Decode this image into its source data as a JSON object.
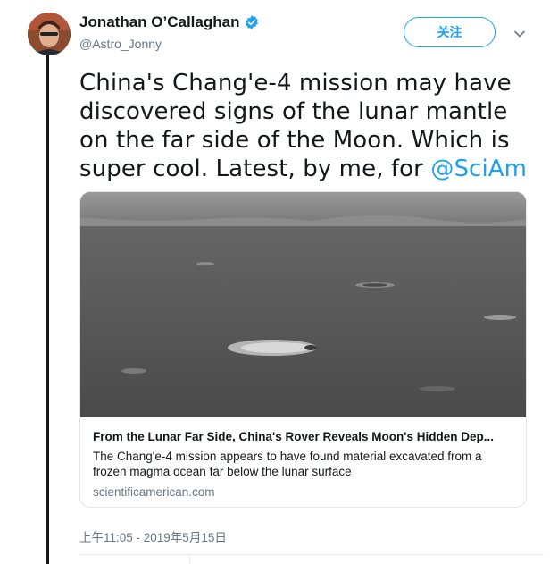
{
  "author": {
    "name": "Jonathan O’Callaghan",
    "handle": "@Astro_Jonny",
    "verified": true
  },
  "follow_button": {
    "label": "关注"
  },
  "tweet": {
    "text": "China's Chang'e-4 mission may have discovered signs of the lunar mantle on the far side of the Moon. Which is super cool. Latest, by me, for ",
    "mention": "@SciAm"
  },
  "card": {
    "title": "From the Lunar Far Side, China's Rover Reveals Moon's Hidden Dep...",
    "description": "The Chang'e-4 mission appears to have found material excavated from a frozen magma ocean far below the lunar surface",
    "domain": "scientificamerican.com"
  },
  "timestamp": "上午11:05 - 2019年5月15日",
  "colors": {
    "accent": "#1da1f2",
    "muted": "#657786",
    "text": "#14171a"
  },
  "icons": {
    "verified": "verified-badge-icon",
    "caret": "chevron-down-icon"
  }
}
